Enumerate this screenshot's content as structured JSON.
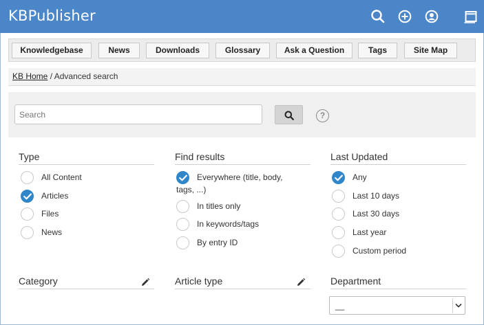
{
  "app": {
    "title": "KBPublisher"
  },
  "header": {
    "icons": [
      "search-icon",
      "add-circle-icon",
      "user-icon",
      "window-icon"
    ]
  },
  "menu": {
    "items": [
      "Knowledgebase",
      "News",
      "Downloads",
      "Glossary",
      "Ask a Question",
      "Tags",
      "Site Map"
    ]
  },
  "breadcrumb": {
    "home": "KB Home",
    "separator": "/",
    "current": "Advanced search"
  },
  "search": {
    "placeholder": "Search",
    "value": "",
    "help_label": "?"
  },
  "type": {
    "title": "Type",
    "options": [
      {
        "label": "All Content",
        "checked": false
      },
      {
        "label": "Articles",
        "checked": true
      },
      {
        "label": "Files",
        "checked": false
      },
      {
        "label": "News",
        "checked": false
      }
    ]
  },
  "find_results": {
    "title": "Find results",
    "options": [
      {
        "label_line1": "Everywhere (title, body,",
        "label_line2": "tags, ...)",
        "checked": true
      },
      {
        "label": "In titles only",
        "checked": false
      },
      {
        "label": "In keywords/tags",
        "checked": false
      },
      {
        "label": "By entry ID",
        "checked": false
      }
    ]
  },
  "last_updated": {
    "title": "Last Updated",
    "options": [
      {
        "label": "Any",
        "checked": true
      },
      {
        "label": "Last 10 days",
        "checked": false
      },
      {
        "label": "Last 30 days",
        "checked": false
      },
      {
        "label": "Last year",
        "checked": false
      },
      {
        "label": "Custom period",
        "checked": false
      }
    ]
  },
  "filters": {
    "category": {
      "title": "Category"
    },
    "article_type": {
      "title": "Article type"
    },
    "department": {
      "title": "Department",
      "selected": "__"
    }
  },
  "colors": {
    "header": "#4a86c8",
    "checked_radio": "#2f86c9"
  }
}
